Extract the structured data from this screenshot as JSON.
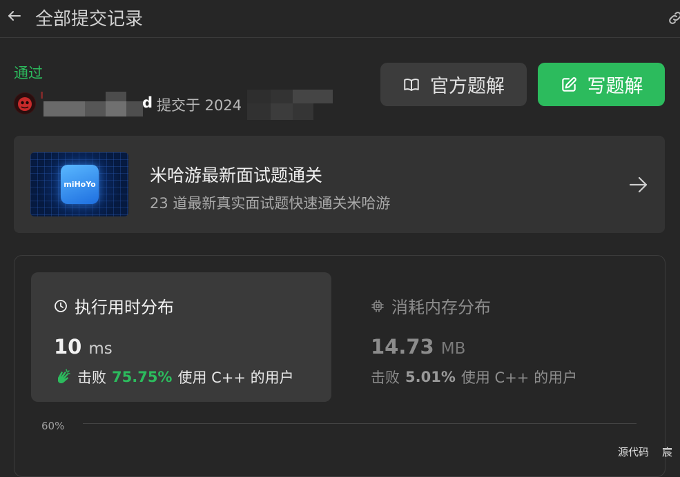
{
  "header": {
    "title": "全部提交记录"
  },
  "submission": {
    "status": "通过",
    "submitter_suffix": "d",
    "submitted_prefix": "提交于 2024"
  },
  "actions": {
    "official_solution": "官方题解",
    "write_solution": "写题解"
  },
  "promo": {
    "logo_text": "miHoYo",
    "title": "米哈游最新面试题通关",
    "subtitle": "23 道最新真实面试题快速通关米哈游"
  },
  "runtime": {
    "label": "执行用时分布",
    "value": "10",
    "unit": "ms",
    "beats_prefix": "击败",
    "beats_pct": "75.75%",
    "beats_suffix": "使用 C++ 的用户"
  },
  "memory": {
    "label": "消耗内存分布",
    "value": "14.73",
    "unit": "MB",
    "beats_prefix": "击败",
    "beats_pct": "5.01%",
    "beats_suffix": "使用 C++ 的用户"
  },
  "chart": {
    "y_tick": "60%"
  },
  "footer": {
    "source_code": "源代码",
    "extra_char": "宸"
  },
  "colors": {
    "accepted_green": "#2cbb5d",
    "background": "#262626"
  }
}
